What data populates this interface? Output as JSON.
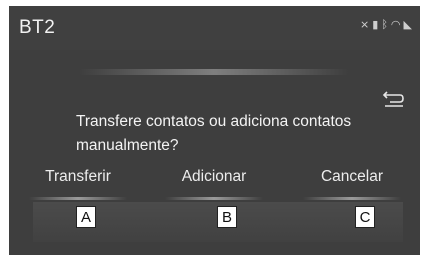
{
  "header": {
    "title": "BT2"
  },
  "status_icons": [
    "mute-icon",
    "battery-icon",
    "bluetooth-icon",
    "wifi-icon",
    "signal-icon"
  ],
  "dialog": {
    "message": "Transfere contatos ou adiciona contatos manualmente?",
    "options": {
      "transfer_label": "Transferir",
      "add_label": "Adicionar",
      "cancel_label": "Cancelar"
    }
  },
  "callouts": {
    "a": "A",
    "b": "B",
    "c": "C"
  },
  "colors": {
    "screen_bg": "#3e3e3e",
    "text": "#f4f4f4"
  }
}
